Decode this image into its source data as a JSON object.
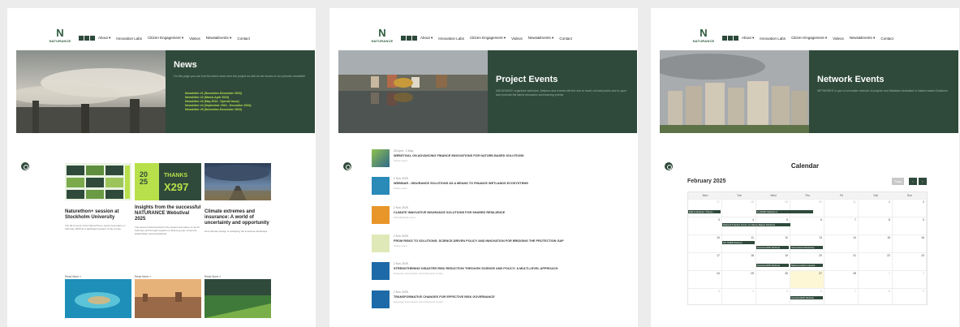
{
  "brand": {
    "mark": "N",
    "name": "NATURANCE"
  },
  "nav": [
    "About ▾",
    "Innovation Labs",
    "Citizen Engagement ▾",
    "Videos",
    "News&Events ▾",
    "Contact"
  ],
  "news": {
    "title": "News",
    "intro": "On this page you can find the latest news from the project as well as the issues of our periodic newsletter",
    "newsletters": [
      "Newsletter #1 (November-December 2023)",
      "Newsletter #2 (March-April 2024)",
      "Newsletter #3 (May 2024 - Special Issue)",
      "Newsletter #4 (September 2024 - December 2024)",
      "Newsletter #5 (November-December 2024)"
    ],
    "cards": [
      {
        "title": "Naturethon+ session at Stockholm University",
        "excerpt": "The #4 & event of the NatureThon+ series took place on February 2025 as a dedicated session of the course",
        "more": "Read More »"
      },
      {
        "title": "Insights from the successful NATURANCE Webstival 2025",
        "excerpt": "The second virtual festival of the project took place on 11-13 February and brought together a diverse group of experts, stakeholders and participants.",
        "more": "Read More »"
      },
      {
        "title": "Climate extremes and insurance: A world of uncertainty and opportunity",
        "excerpt": "How climate change is reshaping the insurance landscape",
        "more": "Read More »"
      }
    ],
    "thumb_text": {
      "thanks": "THANKS",
      "count": "X297",
      "year1": "20",
      "year2": "25"
    }
  },
  "project": {
    "title": "Project Events",
    "intro": "NATURANCE organises webinars, features and events with the aim to reach a broad public and to open and promote the latest innovation and learning events",
    "events": [
      {
        "date": "28 April - 3 May",
        "title": "WEBSTIVAL ON ADVANCING FINANCE INNOVATIONS FOR NATURE-BASED SOLUTIONS",
        "loc": "Online event"
      },
      {
        "date": "2 Nov 2025",
        "title": "WEBINAR - INSURANCE SOLUTIONS AS A MEANS TO FINANCE WETLANDS ECOSYSTEMS",
        "loc": "Online event"
      },
      {
        "date": "2 Nov 2025",
        "title": "CLIMATE INNOVATIVE INSURANCE SOLUTIONS FOR SHARED RESILIENCE",
        "loc": "NATURANCE event"
      },
      {
        "date": "2 Nov 2025",
        "title": "FROM RISKS TO SOLUTIONS: SCIENCE-DRIVEN POLICY AND INNOVATION FOR BRIDGING THE PROTECTION GAP",
        "loc": "Online event"
      },
      {
        "date": "2 Nov 2025",
        "title": "STRENGTHENING DISASTER RISK REDUCTION THROUGH SCIENCE AND POLICY: A MULTI-LEVEL APPROACH",
        "loc": "European Commission Joint Research Centre"
      },
      {
        "date": "2 Nov 2025",
        "title": "TRANSFORMATIVE CHANGES FOR EFFECTIVE RISK GOVERNANCE",
        "loc": "European Commission Joint Research Centre"
      }
    ]
  },
  "network": {
    "title": "Network Events",
    "intro": "NETWORKS is part of a broader network of projects and initiatives dedicated to Nature-based Solutions",
    "calendar": {
      "title": "Calendar",
      "month": "February 2025",
      "today_btn": "Today",
      "prev": "‹",
      "next": "›",
      "weekdays": [
        "Mon",
        "Tue",
        "Wed",
        "Thu",
        "Fri",
        "Sat",
        "Sun"
      ],
      "weeks": [
        [
          "27",
          "28",
          "29",
          "30",
          "31",
          "1",
          "2"
        ],
        [
          "3",
          "4",
          "5",
          "6",
          "7",
          "8",
          "9"
        ],
        [
          "10",
          "11",
          "12",
          "13",
          "14",
          "15",
          "16"
        ],
        [
          "17",
          "18",
          "19",
          "20",
          "21",
          "22",
          "23"
        ],
        [
          "24",
          "25",
          "26",
          "27",
          "28",
          "1",
          "2"
        ],
        [
          "3",
          "4",
          "5",
          "6",
          "7",
          "8",
          "9"
        ]
      ],
      "events": [
        "EWLA Webinar: Thurso...",
        "Fr-RNAR Webinar 4",
        "National Practice Forum on Nature-Based Solutions",
        "NP-NNEB Webinar",
        "InsuranceNW Webinar",
        "International Workshop",
        "InsuranceNW Webinar",
        "Nature-positive impacts",
        "InsuranceNW Webinar"
      ]
    }
  },
  "colors": {
    "accent": "#2f4a3b",
    "lime": "#b8e04a",
    "today": "#fdf7d6"
  }
}
